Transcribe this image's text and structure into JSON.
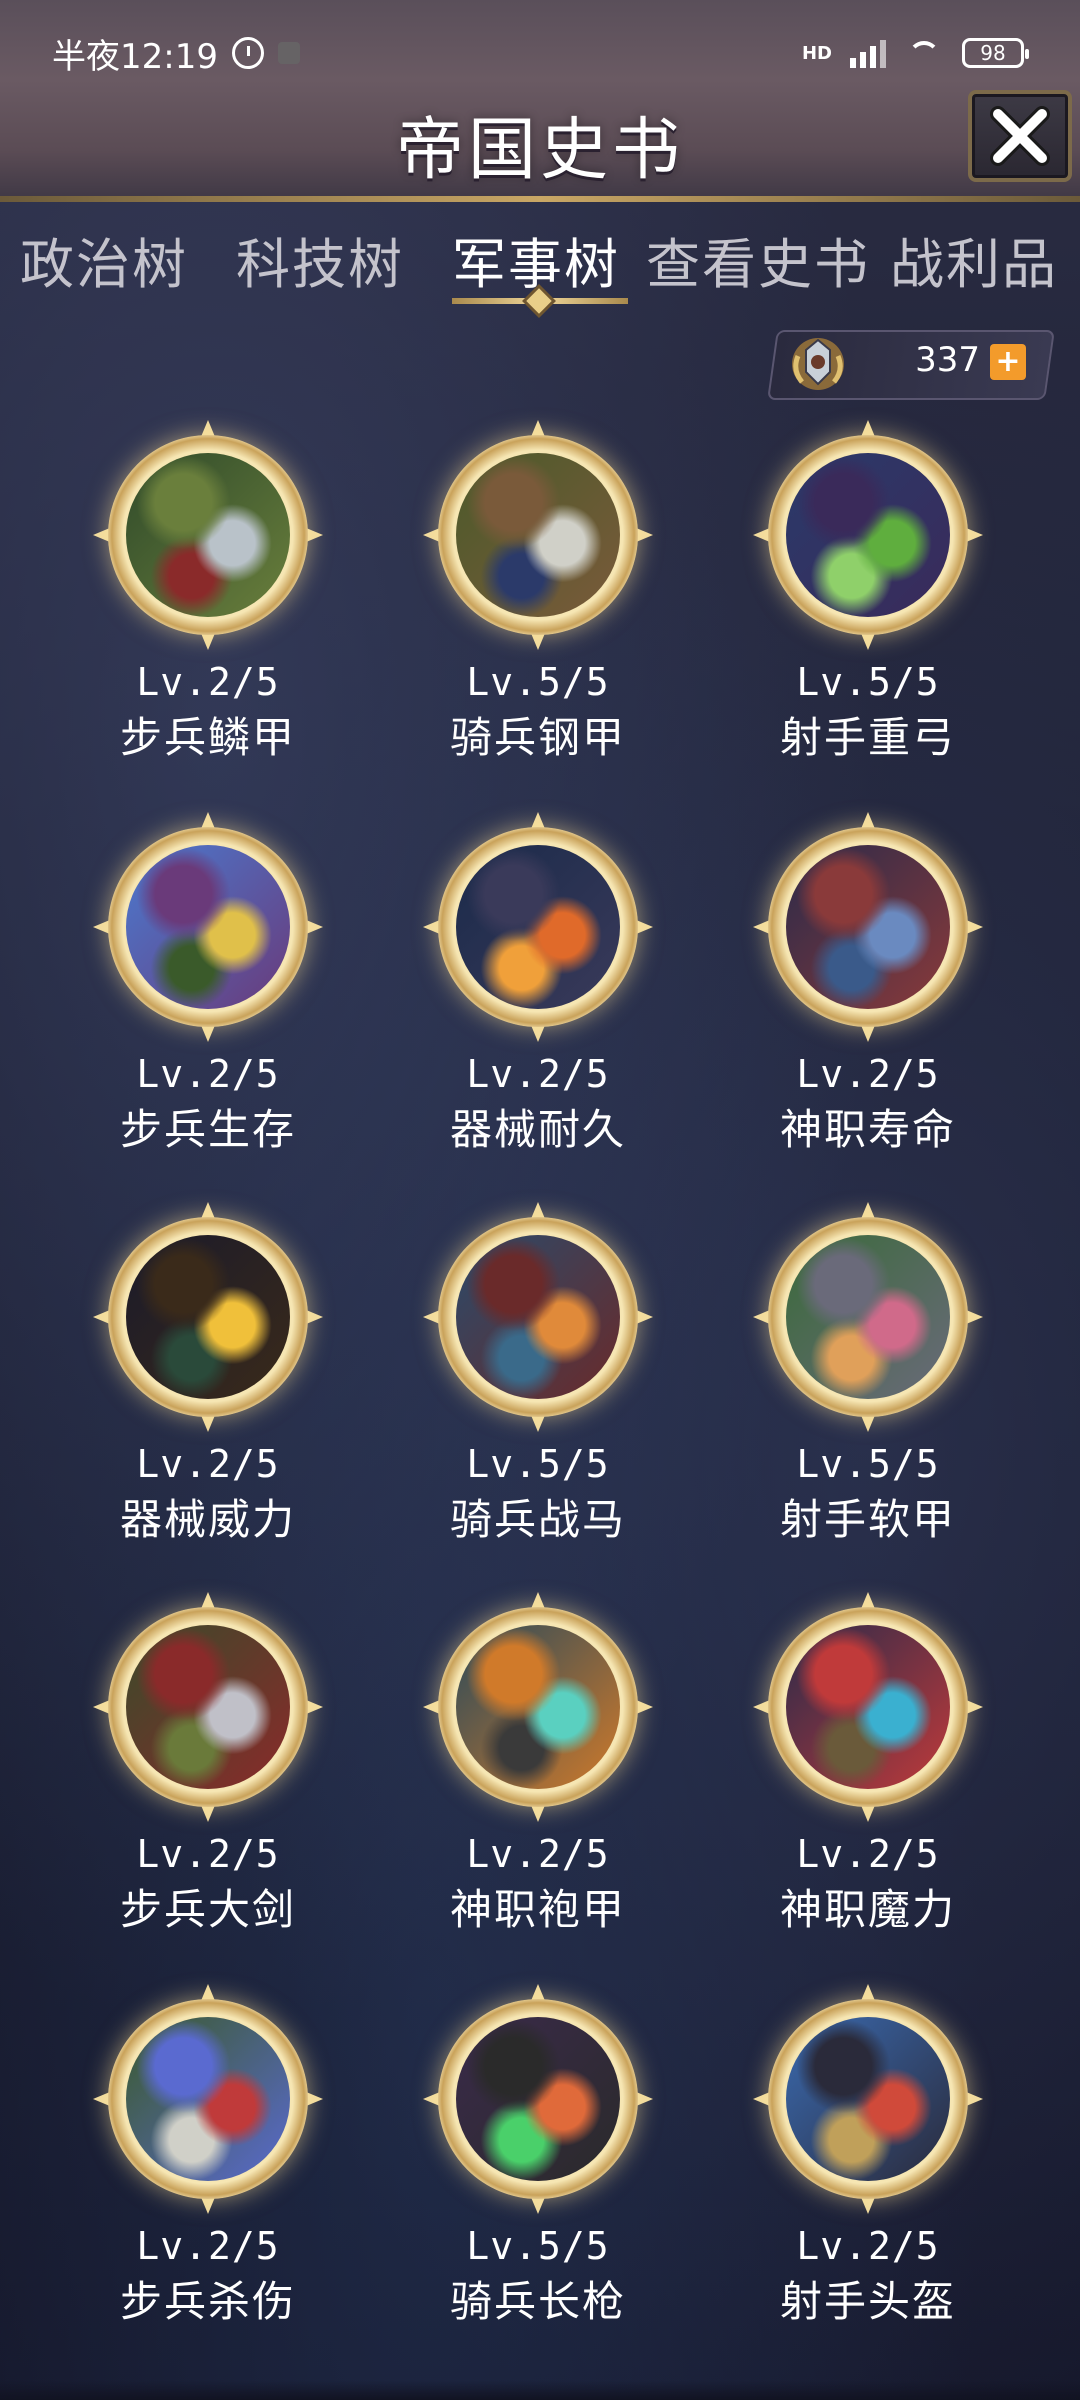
{
  "status_bar": {
    "time": "半夜12:19",
    "network": "HD",
    "battery": "98"
  },
  "header": {
    "title": "帝国史书",
    "close_icon": "close-x-icon"
  },
  "tabs": [
    {
      "label": "政治树",
      "active": false
    },
    {
      "label": "科技树",
      "active": false
    },
    {
      "label": "军事树",
      "active": true
    },
    {
      "label": "查看史书",
      "active": false
    },
    {
      "label": "战利品",
      "active": false
    }
  ],
  "currency": {
    "value": "337",
    "emblem_icon": "laurel-crest-icon",
    "add_icon": "plus-icon"
  },
  "skills": [
    {
      "level": "Lv.2/5",
      "name": "步兵鳞甲",
      "palette": [
        "#2f4a2a",
        "#b9c2c9",
        "#6a7f3c",
        "#8a2a2a"
      ]
    },
    {
      "level": "Lv.5/5",
      "name": "骑兵钢甲",
      "palette": [
        "#4b5a2a",
        "#d0d0c8",
        "#7a5a3a",
        "#2b3a6a"
      ]
    },
    {
      "level": "Lv.5/5",
      "name": "射手重弓",
      "palette": [
        "#2a3a6a",
        "#5fae3e",
        "#3a2a5a",
        "#8fd06a"
      ]
    },
    {
      "level": "Lv.2/5",
      "name": "步兵生存",
      "palette": [
        "#4a7ad0",
        "#e0c04a",
        "#6a3a7a",
        "#3a5a2a"
      ]
    },
    {
      "level": "Lv.2/5",
      "name": "器械耐久",
      "palette": [
        "#1a2a4a",
        "#e06a2a",
        "#3a3a5a",
        "#f0a03a"
      ]
    },
    {
      "level": "Lv.2/5",
      "name": "神职寿命",
      "palette": [
        "#2a2a4a",
        "#6a8ac0",
        "#8a3a3a",
        "#3a5a8a"
      ]
    },
    {
      "level": "Lv.2/5",
      "name": "器械威力",
      "palette": [
        "#1a1a2a",
        "#f0c03a",
        "#3a2a1a",
        "#2a4a3a"
      ]
    },
    {
      "level": "Lv.5/5",
      "name": "骑兵战马",
      "palette": [
        "#2a4a6a",
        "#e08a3a",
        "#6a2a2a",
        "#3a6a8a"
      ]
    },
    {
      "level": "Lv.5/5",
      "name": "射手软甲",
      "palette": [
        "#3a6a3a",
        "#d06a8a",
        "#6a6a7a",
        "#e0a05a"
      ]
    },
    {
      "level": "Lv.2/5",
      "name": "步兵大剑",
      "palette": [
        "#3a4a2a",
        "#c0c0c8",
        "#8a2a2a",
        "#6a7a3a"
      ]
    },
    {
      "level": "Lv.2/5",
      "name": "神职袍甲",
      "palette": [
        "#2a4a5a",
        "#5ad0c0",
        "#d07a2a",
        "#3a3a3a"
      ]
    },
    {
      "level": "Lv.2/5",
      "name": "神职魔力",
      "palette": [
        "#2a2a4a",
        "#3ab0d0",
        "#c03a3a",
        "#6a5a3a"
      ]
    },
    {
      "level": "Lv.2/5",
      "name": "步兵杀伤",
      "palette": [
        "#3a5a2a",
        "#c03a3a",
        "#5a6ad0",
        "#d0d0c8"
      ]
    },
    {
      "level": "Lv.5/5",
      "name": "骑兵长枪",
      "palette": [
        "#3a2a4a",
        "#e06a3a",
        "#2a2a2a",
        "#4ad06a"
      ]
    },
    {
      "level": "Lv.2/5",
      "name": "射手头盔",
      "palette": [
        "#3a6ab0",
        "#d04a3a",
        "#2a2a3a",
        "#c0a05a"
      ]
    }
  ]
}
